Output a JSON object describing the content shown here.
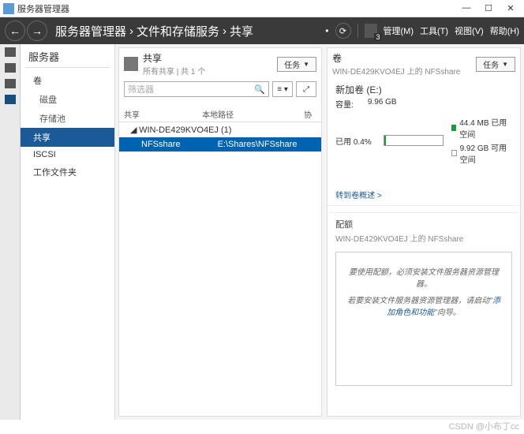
{
  "window": {
    "title": "服务器管理器",
    "btn_min": "—",
    "btn_max": "☐",
    "btn_close": "✕"
  },
  "header": {
    "back": "←",
    "fwd": "→",
    "crumb1": "服务器管理器",
    "crumb2": "文件和存储服务",
    "crumb3": "共享",
    "sep": "›",
    "refresh": "⟳",
    "flag_num": "3",
    "menu_manage": "管理(M)",
    "menu_tools": "工具(T)",
    "menu_view": "视图(V)",
    "menu_help": "帮助(H)"
  },
  "sidebar": {
    "title": "服务器",
    "items": [
      {
        "label": "卷"
      },
      {
        "label": "磁盘"
      },
      {
        "label": "存储池"
      },
      {
        "label": "共享",
        "selected": true
      },
      {
        "label": "ISCSI"
      },
      {
        "label": "工作文件夹"
      }
    ]
  },
  "shares_pane": {
    "title": "共享",
    "subtitle": "所有共享 | 共 1 个",
    "task_label": "任务",
    "search_placeholder": "筛选器",
    "col_share": "共享",
    "col_path": "本地路径",
    "col_proto": "协",
    "server_row": "WIN-DE429KVO4EJ (1)",
    "share_name": "NFSshare",
    "share_path": "E:\\Shares\\NFSshare"
  },
  "volume_pane": {
    "title": "卷",
    "subtitle": "WIN-DE429KVO4EJ 上的 NFSshare",
    "task_label": "任务",
    "vol_name": "新加卷 (E:)",
    "cap_label": "容量:",
    "cap_value": "9.96 GB",
    "used_label": "已用 0.4%",
    "legend_used": "44.4 MB 已用空间",
    "legend_free": "9.92 GB 可用空间",
    "goto": "转到卷概述 >"
  },
  "quota_pane": {
    "title": "配额",
    "subtitle": "WIN-DE429KVO4EJ 上的 NFSshare",
    "msg1": "要使用配额，必须安装文件服务器资源管理器。",
    "msg2a": "若要安装文件服务器资源管理器，请启动\"",
    "msg2b": "添加角色和功能",
    "msg2c": "\"向导。"
  },
  "watermark": "CSDN @小布丁cc"
}
